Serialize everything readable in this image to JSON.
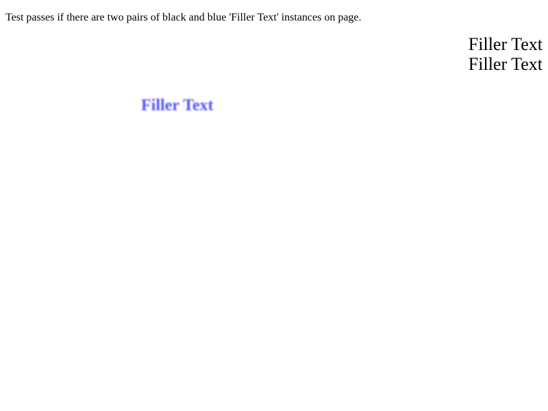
{
  "instructions": "Test passes if there are two pairs of black and blue 'Filler Text' instances on page.",
  "black_fillers": [
    "Filler Text",
    "Filler Text"
  ],
  "blue_filler": "Filler Text",
  "colors": {
    "text": "#000000",
    "blue": "#3333ff",
    "background": "#ffffff"
  }
}
